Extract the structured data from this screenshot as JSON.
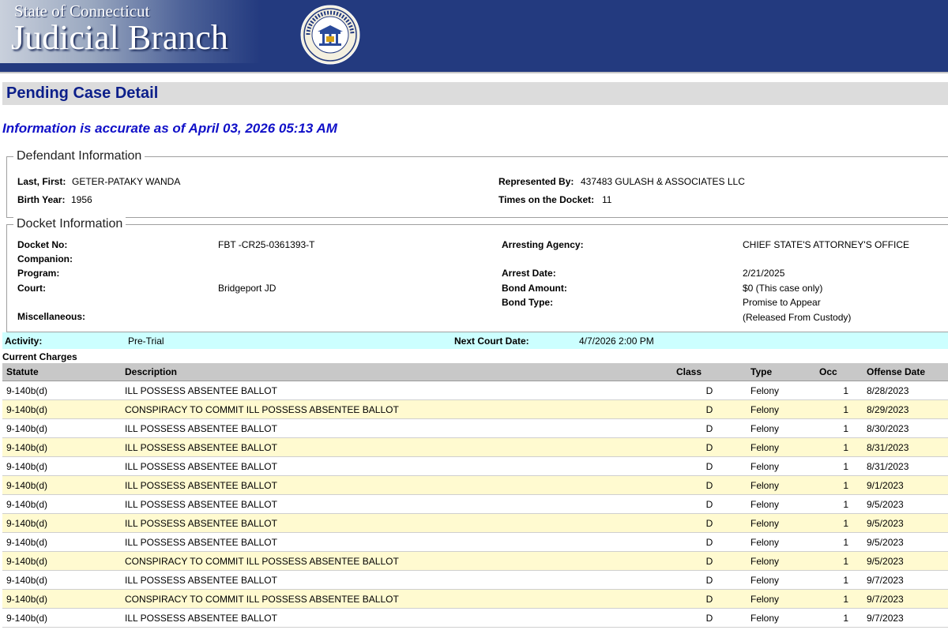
{
  "header": {
    "state_line": "State of Connecticut",
    "branch_line": "Judicial Branch",
    "seal_text": "STATE OF CONNECTICUT JUDICIAL BRANCH"
  },
  "page": {
    "title": "Pending Case Detail",
    "accuracy": "Information is accurate as of April 03, 2026 05:13 AM"
  },
  "defendant": {
    "legend": "Defendant Information",
    "name_label": "Last, First:",
    "name": "GETER-PATAKY WANDA",
    "birth_label": "Birth Year:",
    "birth_year": "1956",
    "rep_label": "Represented By:",
    "represented_by": "437483 GULASH & ASSOCIATES LLC",
    "times_label": "Times on the Docket:",
    "times": "11"
  },
  "docket": {
    "legend": "Docket Information",
    "docket_no_label": "Docket No:",
    "docket_no": "FBT -CR25-0361393-T",
    "companion_label": "Companion:",
    "program_label": "Program:",
    "court_label": "Court:",
    "court": "Bridgeport JD",
    "misc_label": "Miscellaneous:",
    "agency_label": "Arresting Agency:",
    "agency": "CHIEF STATE'S ATTORNEY'S OFFICE",
    "arrest_date_label": "Arrest Date:",
    "arrest_date": "2/21/2025",
    "bond_amount_label": "Bond Amount:",
    "bond_amount": "$0 (This case only)",
    "bond_type_label": "Bond Type:",
    "bond_type": "Promise to Appear",
    "bond_type_note": "(Released From Custody)"
  },
  "activity": {
    "activity_label": "Activity:",
    "activity": "Pre-Trial",
    "next_court_label": "Next Court Date:",
    "next_court_date": "4/7/2026 2:00 PM"
  },
  "charges": {
    "label": "Current Charges",
    "headers": [
      "Statute",
      "Description",
      "Class",
      "Type",
      "Occ",
      "Offense Date"
    ],
    "rows": [
      [
        "9-140b(d)",
        "ILL POSSESS ABSENTEE BALLOT",
        "D",
        "Felony",
        "1",
        "8/28/2023"
      ],
      [
        "9-140b(d)",
        "CONSPIRACY TO COMMIT ILL POSSESS ABSENTEE BALLOT",
        "D",
        "Felony",
        "1",
        "8/29/2023"
      ],
      [
        "9-140b(d)",
        "ILL POSSESS ABSENTEE BALLOT",
        "D",
        "Felony",
        "1",
        "8/30/2023"
      ],
      [
        "9-140b(d)",
        "ILL POSSESS ABSENTEE BALLOT",
        "D",
        "Felony",
        "1",
        "8/31/2023"
      ],
      [
        "9-140b(d)",
        "ILL POSSESS ABSENTEE BALLOT",
        "D",
        "Felony",
        "1",
        "8/31/2023"
      ],
      [
        "9-140b(d)",
        "ILL POSSESS ABSENTEE BALLOT",
        "D",
        "Felony",
        "1",
        "9/1/2023"
      ],
      [
        "9-140b(d)",
        "ILL POSSESS ABSENTEE BALLOT",
        "D",
        "Felony",
        "1",
        "9/5/2023"
      ],
      [
        "9-140b(d)",
        "ILL POSSESS ABSENTEE BALLOT",
        "D",
        "Felony",
        "1",
        "9/5/2023"
      ],
      [
        "9-140b(d)",
        "ILL POSSESS ABSENTEE BALLOT",
        "D",
        "Felony",
        "1",
        "9/5/2023"
      ],
      [
        "9-140b(d)",
        "CONSPIRACY TO COMMIT ILL POSSESS ABSENTEE BALLOT",
        "D",
        "Felony",
        "1",
        "9/5/2023"
      ],
      [
        "9-140b(d)",
        "ILL POSSESS ABSENTEE BALLOT",
        "D",
        "Felony",
        "1",
        "9/7/2023"
      ],
      [
        "9-140b(d)",
        "CONSPIRACY TO COMMIT ILL POSSESS ABSENTEE BALLOT",
        "D",
        "Felony",
        "1",
        "9/7/2023"
      ],
      [
        "9-140b(d)",
        "ILL POSSESS ABSENTEE BALLOT",
        "D",
        "Felony",
        "1",
        "9/7/2023"
      ]
    ]
  },
  "colors": {
    "banner": "#233a7f",
    "title_text": "#0c1f8a",
    "accuracy_text": "#1010c8",
    "activity_bar": "#ccffff",
    "alt_row": "#fffad0"
  }
}
